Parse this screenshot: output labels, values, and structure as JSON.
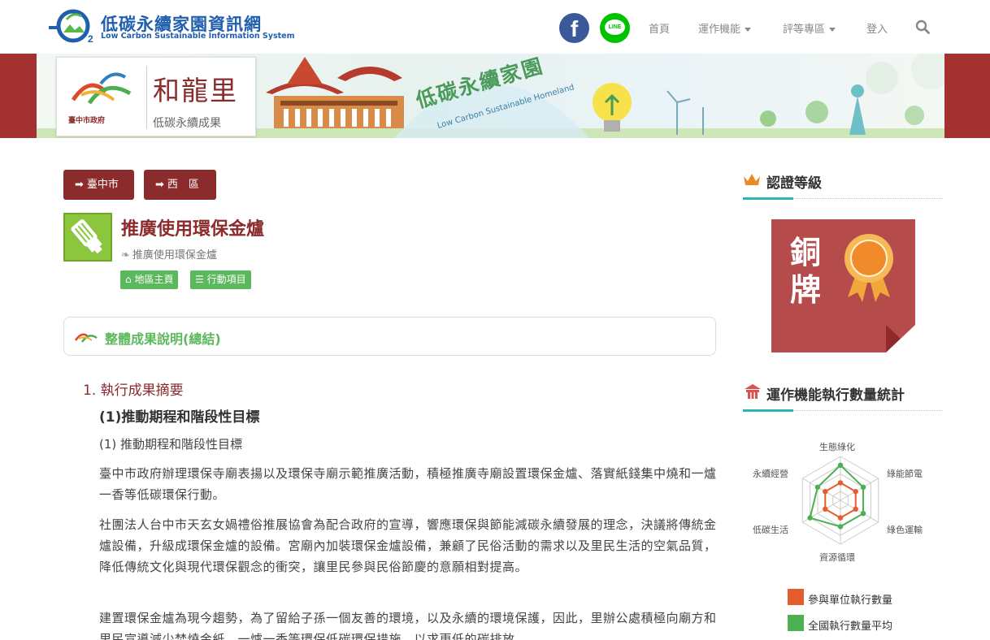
{
  "header": {
    "logo_title": "低碳永續家園資訊網",
    "logo_subtitle": "Low Carbon Sustainable Information System",
    "facebook_icon": "facebook-icon",
    "line_icon_text": "LINE",
    "nav": {
      "home": "首頁",
      "functions": "運作機能",
      "rating": "評等專區",
      "login": "登入"
    },
    "search_icon": "search-icon"
  },
  "banner": {
    "village": "和龍里",
    "subtitle": "低碳永續成果",
    "gov_name": "臺中市政府",
    "slogan": "低碳永續家園",
    "slogan_en": "Low Carbon Sustainable Homeland"
  },
  "breadcrumb": {
    "city": "臺中市",
    "district": "西　區"
  },
  "action": {
    "title": "推廣使用環保金爐",
    "subtitle": "推廣使用環保金爐",
    "tag_home": "地區主頁",
    "tag_items": "行動項目"
  },
  "summary": {
    "label": "整體成果說明(總結)"
  },
  "content": {
    "section1_title": "1. 執行成果摘要",
    "section1_sub": "(1)推動期程和階段性目標",
    "section1_sub2": "(1)  推動期程和階段性目標",
    "paragraphs": [
      "臺中市政府辦理環保寺廟表揚以及環保寺廟示範推廣活動，積極推廣寺廟設置環保金爐、落實紙錢集中燒和一爐一香等低碳環保行動。",
      "社團法人台中市天玄女媧禮俗推展協會為配合政府的宣導，響應環保與節能減碳永續發展的理念，決議將傳統金爐設備，升級成環保金爐的設備。宮廟內加裝環保金爐設備，兼顧了民俗活動的需求以及里民生活的空氣品質，降低傳統文化與現代環保觀念的衝突，讓里民參與民俗節慶的意願相對提高。",
      "建置環保金爐為現今趨勢，為了留給子孫一個友善的環境，以及永續的環境保護，因此，里辦公處積極向廟方和里民宣導減少焚燒金紙、一爐一香等環保低碳環保措施，以求更低的碳排放。"
    ]
  },
  "sidebar": {
    "cert_title": "認證等級",
    "cert_level": "銅牌",
    "stats_title": "運作機能執行數量統計"
  },
  "chart_data": {
    "type": "radar",
    "axes": [
      "生態綠化",
      "綠能節電",
      "綠色運輸",
      "資源循環",
      "低碳生活",
      "永續經營"
    ],
    "series": [
      {
        "name": "參與單位執行數量",
        "color": "#e35d2e",
        "values": [
          2,
          2,
          2,
          2,
          2,
          2
        ]
      },
      {
        "name": "全國執行數量平均",
        "color": "#4caf50",
        "values": [
          4,
          3,
          3,
          3,
          4,
          3
        ]
      }
    ],
    "max": 5
  }
}
